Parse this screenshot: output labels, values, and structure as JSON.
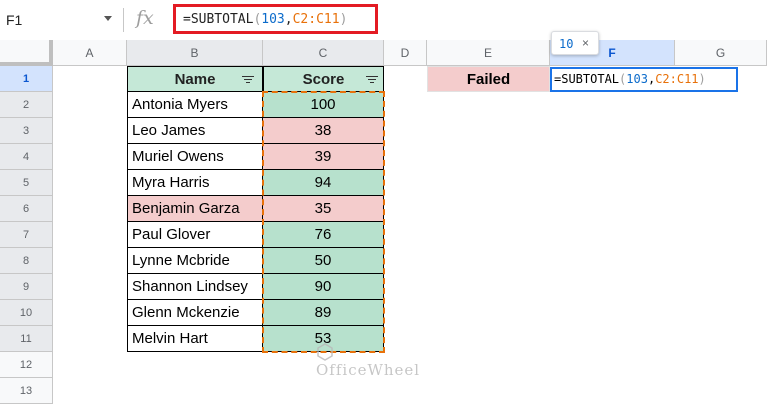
{
  "formula_bar": {
    "cell_ref": "F1",
    "fx_symbol": "fx",
    "formula": {
      "prefix": "=SUBTOTAL",
      "open": "(",
      "arg1": "103",
      "comma": ",",
      "arg2": "C2:C11",
      "close": ")"
    }
  },
  "columns": [
    "A",
    "B",
    "C",
    "D",
    "E",
    "F",
    "G"
  ],
  "rows": [
    "1",
    "2",
    "3",
    "4",
    "5",
    "6",
    "7",
    "8",
    "9",
    "10",
    "11",
    "12",
    "13"
  ],
  "table": {
    "headers": {
      "name": "Name",
      "score": "Score"
    },
    "records": [
      {
        "name": "Antonia Myers",
        "score": "100",
        "status": "pass"
      },
      {
        "name": "Leo James",
        "score": "38",
        "status": "fail"
      },
      {
        "name": "Muriel Owens",
        "score": "39",
        "status": "fail"
      },
      {
        "name": "Myra Harris",
        "score": "94",
        "status": "pass"
      },
      {
        "name": "Benjamin Garza",
        "score": "35",
        "status": "fail"
      },
      {
        "name": "Paul Glover",
        "score": "76",
        "status": "pass"
      },
      {
        "name": "Lynne Mcbride",
        "score": "50",
        "status": "pass"
      },
      {
        "name": "Shannon Lindsey",
        "score": "90",
        "status": "pass"
      },
      {
        "name": "Glenn Mckenzie",
        "score": "89",
        "status": "pass"
      },
      {
        "name": "Melvin Hart",
        "score": "53",
        "status": "pass"
      }
    ]
  },
  "failed_label": "Failed",
  "tooltip": {
    "value": "10",
    "close": "×"
  },
  "watermark": "OfficeWheel",
  "colors": {
    "pass": "#b7e1cd",
    "fail": "#f4cccc",
    "header_green": "#c5e8d7",
    "highlight_red": "#e31b23",
    "range_orange": "#e8710a",
    "select_blue": "#1a73e8"
  }
}
